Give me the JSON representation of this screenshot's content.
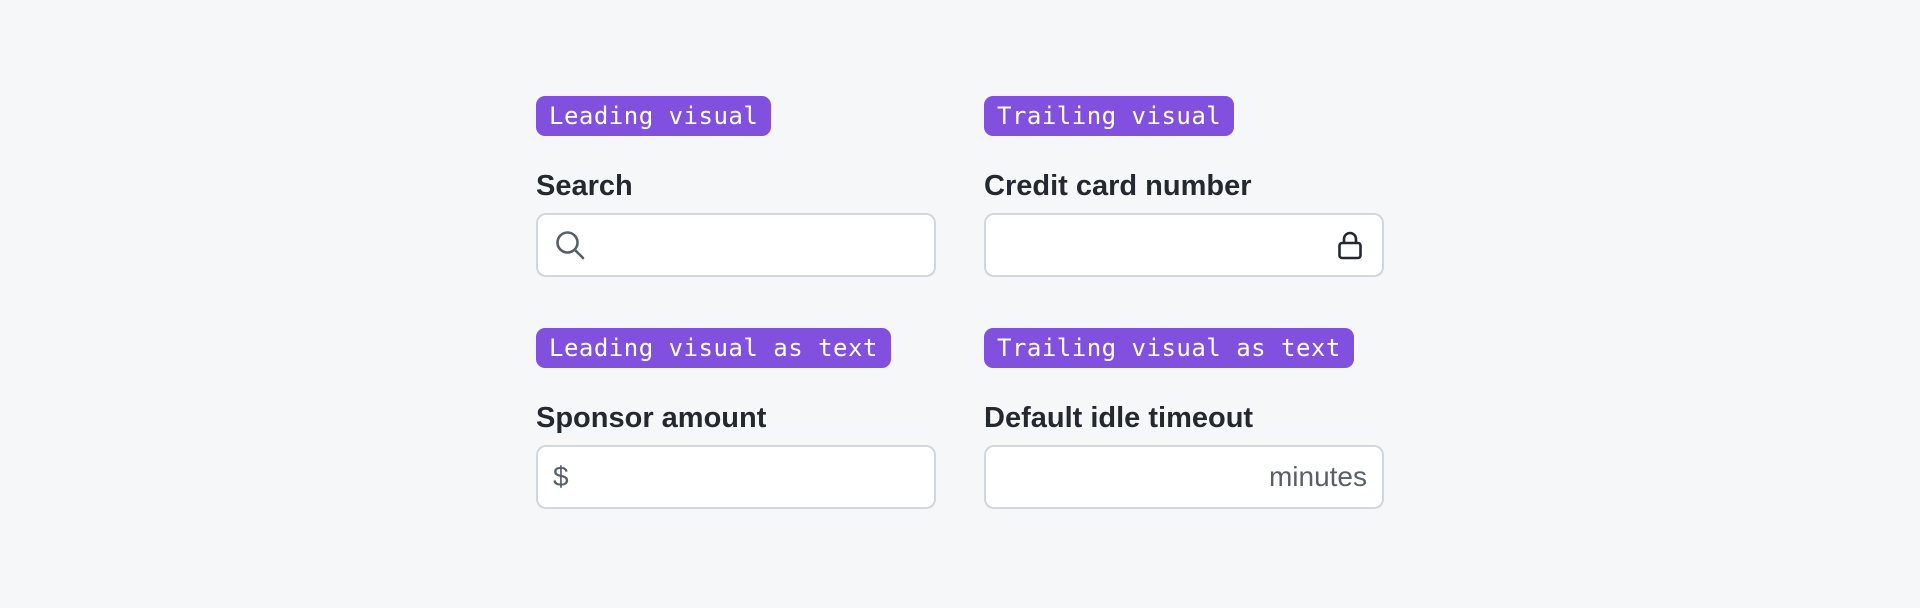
{
  "examples": [
    {
      "tag": "Leading visual",
      "label": "Search",
      "icon": "search-icon",
      "value": ""
    },
    {
      "tag": "Trailing visual",
      "label": "Credit card number",
      "icon": "lock-icon",
      "value": ""
    },
    {
      "tag": "Leading visual as text",
      "label": "Sponsor amount",
      "leading_text": "$",
      "value": ""
    },
    {
      "tag": "Trailing visual as text",
      "label": "Default idle timeout",
      "trailing_text": "minutes",
      "value": ""
    }
  ],
  "colors": {
    "background": "#f6f7f9",
    "tag_background": "#8250df",
    "tag_text": "#ffffff",
    "label_text": "#24292f",
    "input_border": "#d0d7de",
    "visual_text": "#57606a"
  }
}
